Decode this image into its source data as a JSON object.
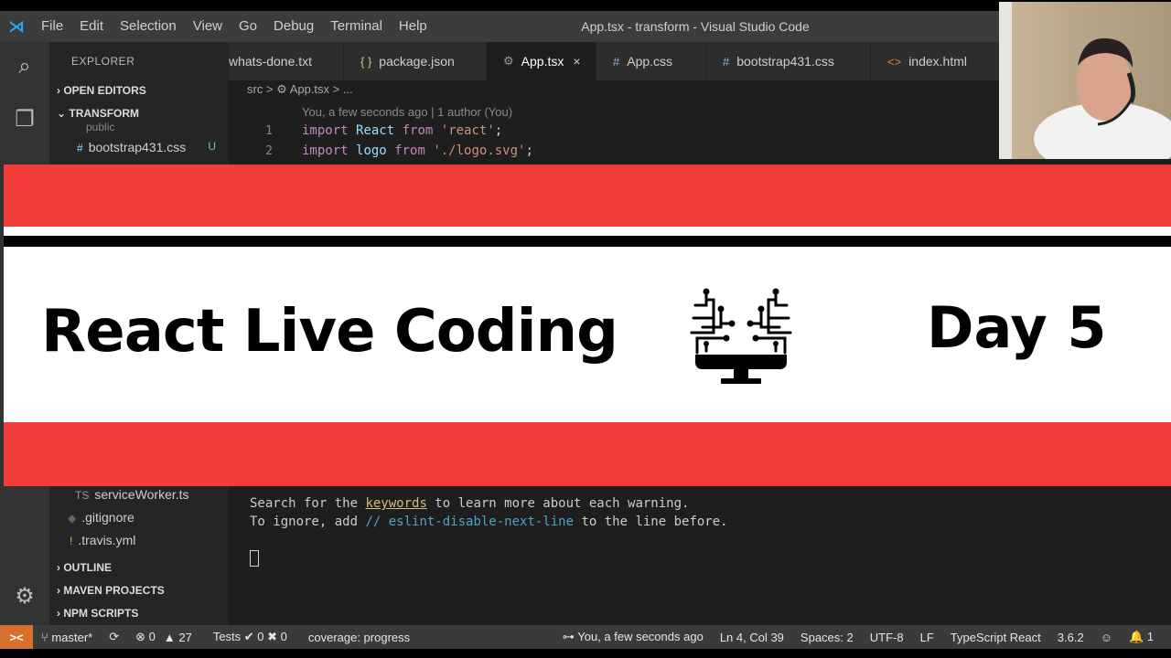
{
  "menubar": {
    "items": [
      "File",
      "Edit",
      "Selection",
      "View",
      "Go",
      "Debug",
      "Terminal",
      "Help"
    ],
    "window_title": "App.tsx - transform - Visual Studio Code"
  },
  "sidebar": {
    "title": "EXPLORER",
    "open_editors": "OPEN EDITORS",
    "project": "TRANSFORM",
    "partial_folder": "public",
    "files_top": [
      {
        "name": "bootstrap431.css",
        "mark": "#",
        "status": "U"
      }
    ],
    "files_bottom": [
      {
        "name": "serviceWorker.ts",
        "mark": "TS"
      },
      {
        "name": ".gitignore",
        "mark": "◆"
      },
      {
        "name": ".travis.yml",
        "mark": "!"
      }
    ],
    "outline": "OUTLINE",
    "maven": "MAVEN PROJECTS",
    "npm": "NPM SCRIPTS"
  },
  "tabs": [
    {
      "label": "whats-done.txt",
      "icon": ""
    },
    {
      "label": "package.json",
      "icon": "{ }"
    },
    {
      "label": "App.tsx",
      "icon": "⚙",
      "active": true,
      "close": "×"
    },
    {
      "label": "App.css",
      "icon": "#"
    },
    {
      "label": "bootstrap431.css",
      "icon": "#"
    },
    {
      "label": "index.html",
      "icon": "<>"
    }
  ],
  "editor": {
    "breadcrumb": "src  >  ⚙ App.tsx  > ...",
    "blame": "You, a few seconds ago | 1 author (You)",
    "lines": [
      {
        "num": "1",
        "kw": "import",
        "id": "React",
        "from": "from",
        "str": "'react'",
        "end": ";"
      },
      {
        "num": "2",
        "kw": "import",
        "id": "logo",
        "from": "from",
        "str": "'./logo.svg'",
        "end": ";"
      }
    ]
  },
  "terminal": {
    "line1_pre": "Search for the ",
    "line1_link": "keywords",
    "line1_post": " to learn more about each warning.",
    "line2_pre": "To ignore, add ",
    "line2_comment": "// eslint-disable-next-line",
    "line2_post": " to the line before."
  },
  "statusbar": {
    "remote": "><",
    "branch": "master*",
    "sync": "⟳",
    "errors": "⊗ 0",
    "warnings": "▲ 27",
    "tests": "Tests ✔ 0  ✖ 0",
    "coverage": "coverage: progress",
    "blame": "You, a few seconds ago",
    "position": "Ln 4, Col 39",
    "spaces": "Spaces: 2",
    "encoding": "UTF-8",
    "eol": "LF",
    "language": "TypeScript React",
    "version": "3.6.2",
    "feedback": "☺",
    "notifications": "🔔 1"
  },
  "banner": {
    "title": "React Live Coding",
    "day": "Day 5",
    "icon": "circuit-monitor-icon"
  },
  "colors": {
    "banner_red": "#f23b3b",
    "editor_bg": "#1e1e1e",
    "statusbar_remote": "#d7702c"
  }
}
